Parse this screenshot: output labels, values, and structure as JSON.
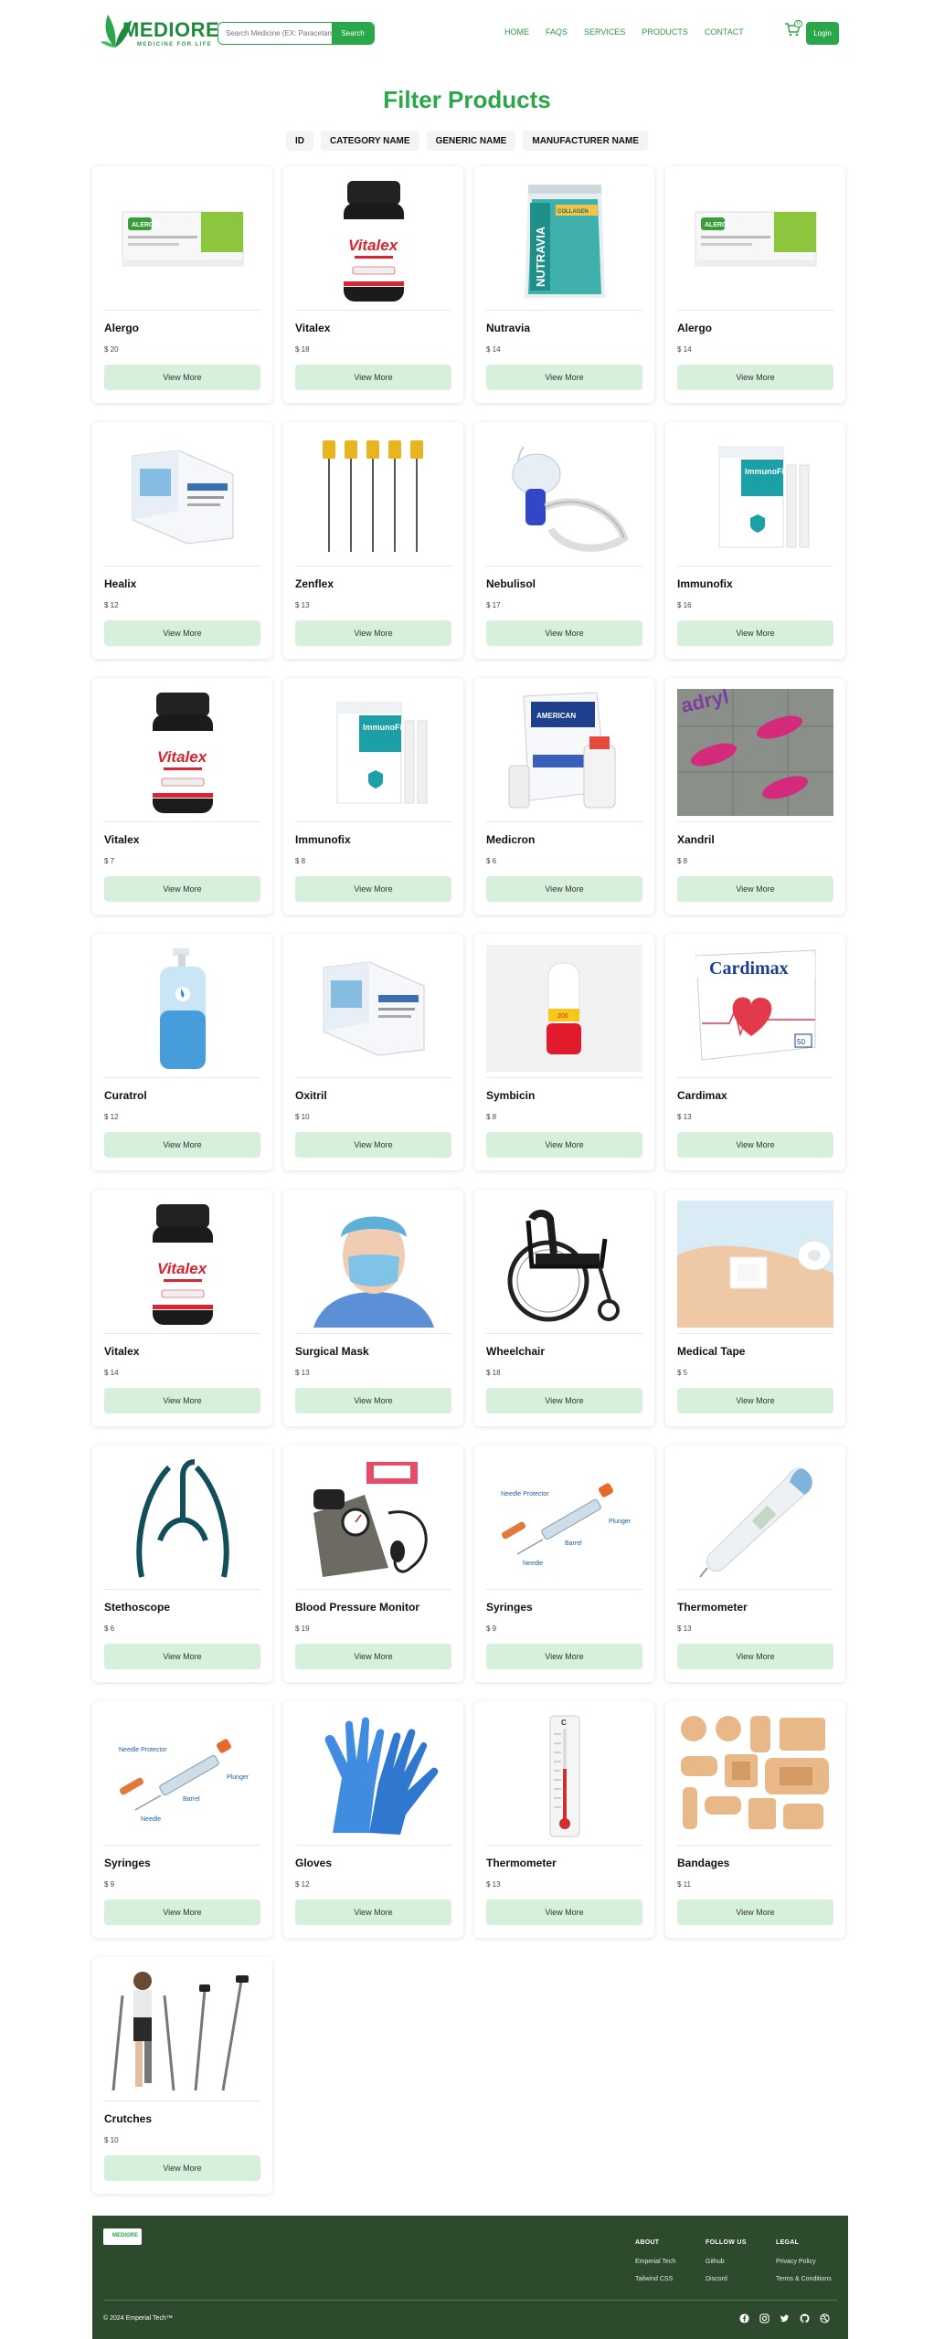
{
  "brand": {
    "name": "MEDIORE",
    "tagline": "MEDICINE FOR LIFE",
    "green": "#2aa74a",
    "dark_green": "#2d4a2d"
  },
  "search": {
    "placeholder": "Search Medicine (EX: Paracetamol)",
    "button": "Search"
  },
  "nav": [
    "HOME",
    "FAQS",
    "SERVICES",
    "PRODUCTS",
    "CONTACT"
  ],
  "cart": {
    "icon": "cart-icon",
    "count": "0"
  },
  "login": "Login",
  "page_title": "Filter Products",
  "filters": [
    "ID",
    "CATEGORY NAME",
    "GENERIC NAME",
    "MANUFACTURER NAME"
  ],
  "view_more_label": "View More",
  "products": [
    {
      "name": "Alergo",
      "price": "$ 20",
      "image": "blister-pack"
    },
    {
      "name": "Vitalex",
      "price": "$ 18",
      "image": "pill-bottle"
    },
    {
      "name": "Nutravia",
      "price": "$ 14",
      "image": "pouch"
    },
    {
      "name": "Alergo",
      "price": "$ 14",
      "image": "blister-pack"
    },
    {
      "name": "Healix",
      "price": "$ 12",
      "image": "box"
    },
    {
      "name": "Zenflex",
      "price": "$ 13",
      "image": "dental-files"
    },
    {
      "name": "Nebulisol",
      "price": "$ 17",
      "image": "nebulizer"
    },
    {
      "name": "Immunofix",
      "price": "$ 16",
      "image": "kit-box"
    },
    {
      "name": "Vitalex",
      "price": "$ 7",
      "image": "pill-bottle"
    },
    {
      "name": "Immunofix",
      "price": "$ 8",
      "image": "kit-box"
    },
    {
      "name": "Medicron",
      "price": "$ 6",
      "image": "vial-box"
    },
    {
      "name": "Xandril",
      "price": "$ 8",
      "image": "pills"
    },
    {
      "name": "Curatrol",
      "price": "$ 12",
      "image": "sanitizer"
    },
    {
      "name": "Oxitril",
      "price": "$ 10",
      "image": "box"
    },
    {
      "name": "Symbicin",
      "price": "$ 8",
      "image": "inhaler"
    },
    {
      "name": "Cardimax",
      "price": "$ 13",
      "image": "cardio-box"
    },
    {
      "name": "Vitalex",
      "price": "$ 14",
      "image": "pill-bottle"
    },
    {
      "name": "Surgical Mask",
      "price": "$ 13",
      "image": "mask"
    },
    {
      "name": "Wheelchair",
      "price": "$ 18",
      "image": "wheelchair"
    },
    {
      "name": "Medical Tape",
      "price": "$ 5",
      "image": "tape"
    },
    {
      "name": "Stethoscope",
      "price": "$ 6",
      "image": "stethoscope"
    },
    {
      "name": "Blood Pressure Monitor",
      "price": "$ 19",
      "image": "bp-monitor"
    },
    {
      "name": "Syringes",
      "price": "$ 9",
      "image": "syringe"
    },
    {
      "name": "Thermometer",
      "price": "$ 13",
      "image": "digital-thermometer"
    },
    {
      "name": "Syringes",
      "price": "$ 9",
      "image": "syringe"
    },
    {
      "name": "Gloves",
      "price": "$ 12",
      "image": "gloves"
    },
    {
      "name": "Thermometer",
      "price": "$ 13",
      "image": "wall-thermometer"
    },
    {
      "name": "Bandages",
      "price": "$ 11",
      "image": "bandages"
    },
    {
      "name": "Crutches",
      "price": "$ 10",
      "image": "crutches"
    }
  ],
  "footer": {
    "columns": [
      {
        "title": "ABOUT",
        "items": [
          "Emperial Tech",
          "Tailwind CSS"
        ]
      },
      {
        "title": "FOLLOW US",
        "items": [
          "Github",
          "Discord"
        ]
      },
      {
        "title": "LEGAL",
        "items": [
          "Privacy Policy",
          "Terms & Conditions"
        ]
      }
    ],
    "copyright": "© 2024 Emperial Tech™",
    "socials": [
      "facebook-icon",
      "instagram-icon",
      "twitter-icon",
      "github-icon",
      "dribbble-icon"
    ]
  }
}
